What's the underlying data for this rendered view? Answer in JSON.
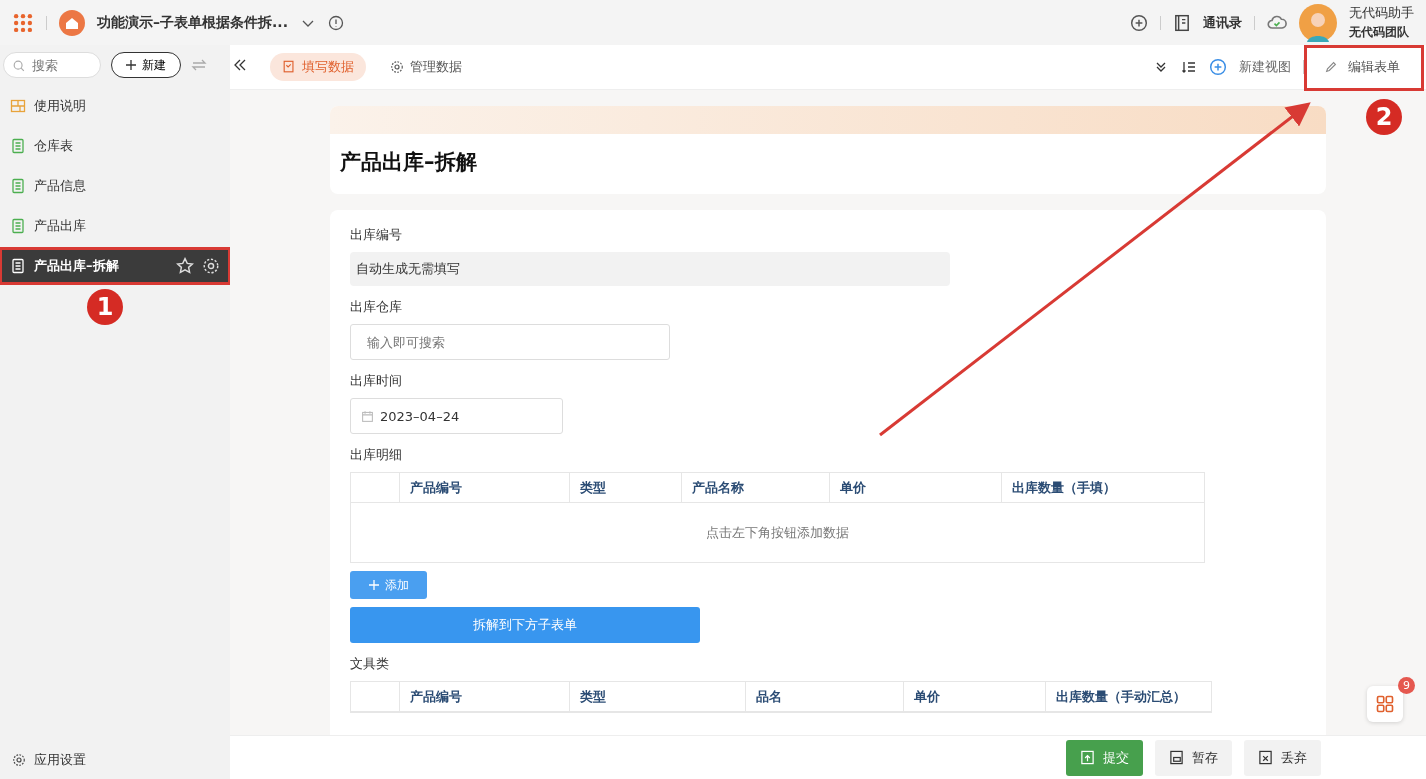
{
  "app_title": "功能演示–子表单根据条件拆...",
  "top_actions": {
    "contacts": "通讯录"
  },
  "user": {
    "name": "无代码助手",
    "team": "无代码团队"
  },
  "sidebar": {
    "search": {
      "placeholder": "搜索"
    },
    "new_button": "新建",
    "items": [
      {
        "label": "使用说明",
        "kind": "guide",
        "selected": false
      },
      {
        "label": "仓库表",
        "kind": "form",
        "selected": false
      },
      {
        "label": "产品信息",
        "kind": "form",
        "selected": false
      },
      {
        "label": "产品出库",
        "kind": "form",
        "selected": false
      },
      {
        "label": "产品出库–拆解",
        "kind": "form",
        "selected": true
      }
    ],
    "settings": "应用设置"
  },
  "tabs": [
    {
      "label": "填写数据",
      "kind": "fill",
      "selected": true
    },
    {
      "label": "管理数据",
      "kind": "manage",
      "selected": false
    }
  ],
  "toolbar": {
    "new_view": "新建视图",
    "edit_form": "编辑表单"
  },
  "form": {
    "title": "产品出库–拆解",
    "fields": [
      {
        "label": "出库编号",
        "kind": "readonly",
        "value": "自动生成无需填写"
      },
      {
        "label": "出库仓库",
        "kind": "search",
        "placeholder": "输入即可搜索"
      },
      {
        "label": "出库时间",
        "kind": "date",
        "value": "2023–04–24"
      }
    ],
    "detail": {
      "label": "出库明细",
      "columns": [
        "产品编号",
        "类型",
        "产品名称",
        "单价",
        "出库数量（手填）"
      ],
      "empty": "点击左下角按钮添加数据",
      "add": "添加"
    },
    "split_button": "拆解到下方子表单",
    "stationery": {
      "label": "文具类",
      "columns": [
        "产品编号",
        "类型",
        "品名",
        "单价",
        "出库数量（手动汇总）"
      ]
    }
  },
  "badge": "9",
  "footer": [
    "提交",
    "暂存",
    "丢弃"
  ],
  "annotations": [
    "1",
    "2"
  ]
}
